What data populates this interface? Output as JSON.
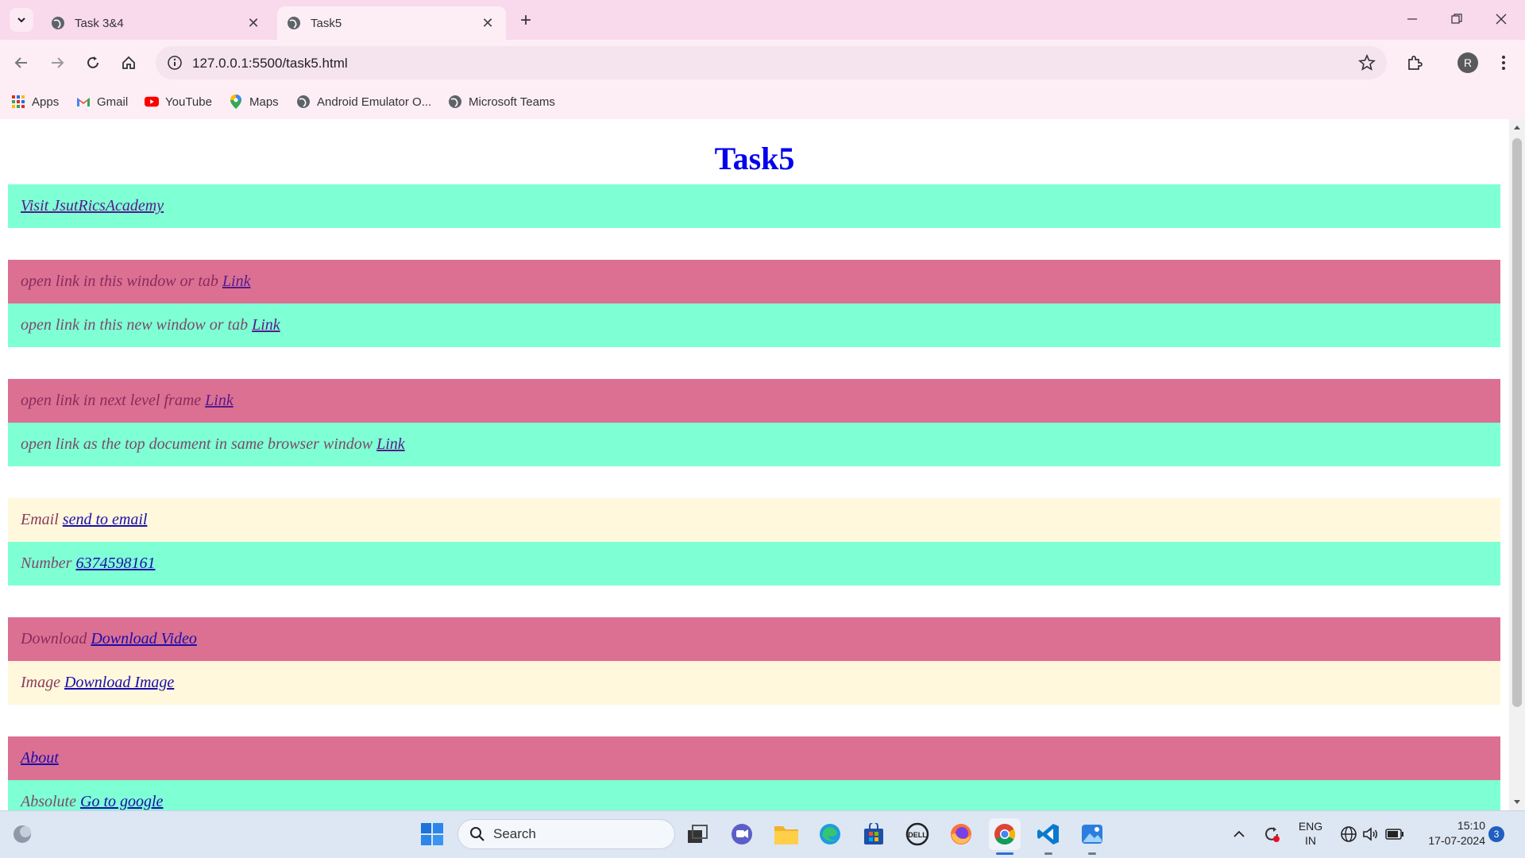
{
  "browser": {
    "tabs": [
      {
        "title": "Task 3&4",
        "active": false
      },
      {
        "title": "Task5",
        "active": true
      }
    ],
    "url": "127.0.0.1:5500/task5.html",
    "profile_initial": "R",
    "bookmarks": [
      {
        "label": "Apps",
        "icon": "apps-grid-icon"
      },
      {
        "label": "Gmail",
        "icon": "gmail-icon"
      },
      {
        "label": "YouTube",
        "icon": "youtube-icon"
      },
      {
        "label": "Maps",
        "icon": "maps-pin-icon"
      },
      {
        "label": "Android Emulator O...",
        "icon": "globe-icon"
      },
      {
        "label": "Microsoft Teams",
        "icon": "globe-icon"
      }
    ]
  },
  "page": {
    "title": "Task5",
    "rows": [
      {
        "label": "",
        "link": "Visit JsutRicsAcademy",
        "color": "aqua",
        "visited": true
      },
      {
        "label": "open link in this window or tab",
        "link": "Link",
        "color": "pink",
        "visited": true
      },
      {
        "label": "open link in this new window or tab",
        "link": "Link",
        "color": "aqua",
        "visited": true
      },
      {
        "label": "open link in next level frame",
        "link": "Link",
        "color": "pink",
        "visited": true
      },
      {
        "label": "open link as the top document in same browser window",
        "link": "Link",
        "color": "aqua",
        "visited": true
      },
      {
        "label": "Email",
        "link": "send to email",
        "color": "cream",
        "visited": false
      },
      {
        "label": "Number",
        "link": "6374598161",
        "color": "aqua",
        "visited": false
      },
      {
        "label": "Download",
        "link": "Download Video",
        "color": "pink",
        "visited": false
      },
      {
        "label": "Image",
        "link": "Download Image",
        "color": "cream",
        "visited": false
      },
      {
        "label": "",
        "link": "About",
        "color": "pink",
        "visited": false
      },
      {
        "label": "Absolute",
        "link": "Go to google",
        "color": "aqua",
        "visited": false
      }
    ]
  },
  "taskbar": {
    "search_placeholder": "Search",
    "language": "ENG",
    "region": "IN",
    "time": "15:10",
    "date": "17-07-2024",
    "notification_count": "3"
  },
  "colors": {
    "aqua": "#7fffd4",
    "pink": "#db7093",
    "cream": "#fff8dc",
    "title": "#0000ee"
  }
}
